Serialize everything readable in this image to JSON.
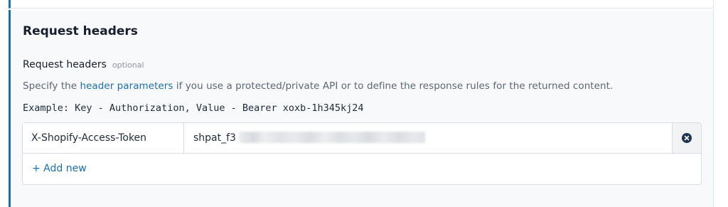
{
  "section": {
    "title": "Request headers"
  },
  "field": {
    "label": "Request headers",
    "optional_tag": "optional",
    "description_before": "Specify the",
    "description_link": "header parameters",
    "description_after": "if you use a protected/private API or to define the response rules for the returned content.",
    "example": "Example: Key - Authorization, Value - Bearer xoxb-1h345kj24"
  },
  "headers": {
    "rows": [
      {
        "key": "X-Shopify-Access-Token",
        "value_visible": "shpat_f3"
      }
    ],
    "add_new_label": "+ Add new"
  },
  "icons": {
    "remove": "close-circle-icon"
  },
  "colors": {
    "accent": "#1d6fa5",
    "remove_icon": "#1f3550"
  }
}
